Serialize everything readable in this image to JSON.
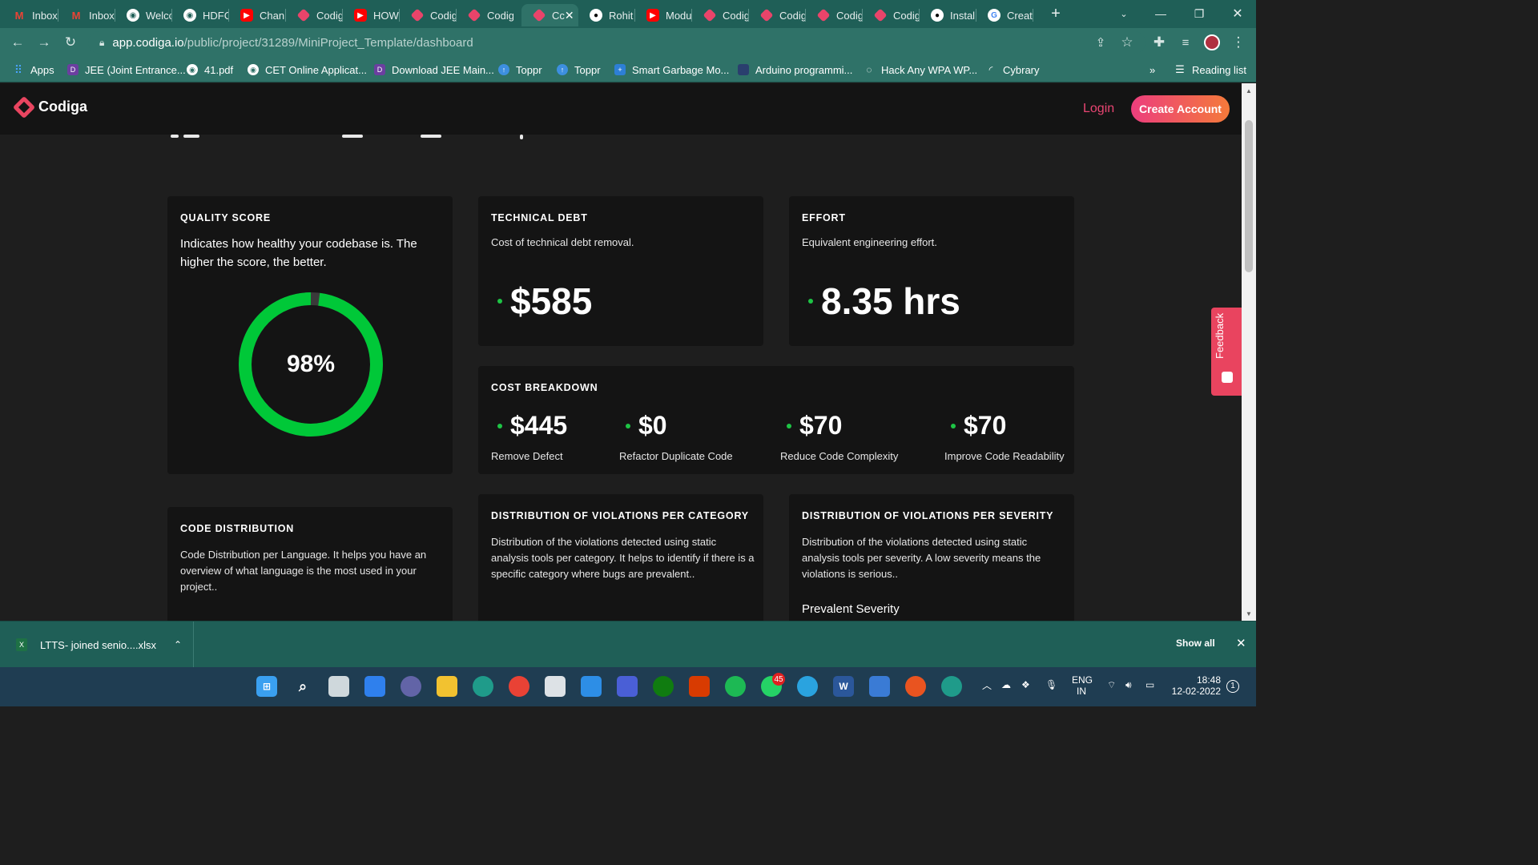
{
  "browser": {
    "tabs": [
      {
        "title": "Inbox",
        "icon": "gmail-icon"
      },
      {
        "title": "Inbox",
        "icon": "gmail-icon"
      },
      {
        "title": "Welcc",
        "icon": "globe-icon"
      },
      {
        "title": "HDFC",
        "icon": "globe-icon"
      },
      {
        "title": "Chan",
        "icon": "youtube-icon"
      },
      {
        "title": "Codig",
        "icon": "codiga-icon"
      },
      {
        "title": "HOW",
        "icon": "youtube-icon"
      },
      {
        "title": "Codig",
        "icon": "codiga-icon"
      },
      {
        "title": "Codig",
        "icon": "codiga-icon"
      },
      {
        "title": "Cc",
        "icon": "codiga-icon",
        "active": true
      },
      {
        "title": "Rohit",
        "icon": "github-icon"
      },
      {
        "title": "Modu",
        "icon": "youtube-icon"
      },
      {
        "title": "Codig",
        "icon": "codiga-icon"
      },
      {
        "title": "Codig",
        "icon": "codiga-icon"
      },
      {
        "title": "Codig",
        "icon": "codiga-icon"
      },
      {
        "title": "Codig",
        "icon": "codiga-icon"
      },
      {
        "title": "Instal",
        "icon": "github-icon"
      },
      {
        "title": "Creat",
        "icon": "google-icon"
      }
    ],
    "url_host": "app.codiga.io",
    "url_path": "/public/project/31289/MiniProject_Template/dashboard",
    "bookmarks": [
      {
        "label": "Apps",
        "icon": "apps-grid-icon"
      },
      {
        "label": "JEE (Joint Entrance...",
        "icon": "bookmark-icon"
      },
      {
        "label": "41.pdf",
        "icon": "globe-icon"
      },
      {
        "label": "CET Online Applicat...",
        "icon": "globe-icon"
      },
      {
        "label": "Download JEE Main...",
        "icon": "bookmark-icon"
      },
      {
        "label": "Toppr",
        "icon": "toppr-icon"
      },
      {
        "label": "Toppr",
        "icon": "toppr-icon"
      },
      {
        "label": "Smart Garbage Mo...",
        "icon": "bookmark-icon"
      },
      {
        "label": "Arduino programmi...",
        "icon": "bookmark-icon"
      },
      {
        "label": "Hack Any WPA WP...",
        "icon": "bookmark-icon"
      },
      {
        "label": "Cybrary",
        "icon": "bookmark-icon"
      }
    ],
    "overflow": "»",
    "reading_list": "Reading list"
  },
  "site": {
    "brand": "Codiga",
    "login": "Login",
    "create_account": "Create Account",
    "feedback": "Feedback"
  },
  "dashboard": {
    "quality": {
      "title": "QUALITY SCORE",
      "desc": "Indicates how healthy your codebase is. The higher the score, the better.",
      "score_label": "98%",
      "score": 0.98,
      "ring_color": "#00c838"
    },
    "debt": {
      "title": "TECHNICAL DEBT",
      "desc": "Cost of technical debt removal.",
      "value": "$585"
    },
    "effort": {
      "title": "EFFORT",
      "desc": "Equivalent engineering effort.",
      "value": "8.35 hrs"
    },
    "cost_breakdown": {
      "title": "COST BREAKDOWN",
      "items": [
        {
          "value": "$445",
          "label": "Remove Defect"
        },
        {
          "value": "$0",
          "label": "Refactor Duplicate Code"
        },
        {
          "value": "$70",
          "label": "Reduce Code Complexity"
        },
        {
          "value": "$70",
          "label": "Improve Code Readability"
        }
      ]
    },
    "code_distribution": {
      "title": "CODE DISTRIBUTION",
      "desc": "Code Distribution per Language. It helps you have an overview of what language is the most used in your project.."
    },
    "violations_category": {
      "title": "DISTRIBUTION OF VIOLATIONS PER CATEGORY",
      "desc": "Distribution of the violations detected using static analysis tools per category. It helps to identify if there is a specific category where bugs are prevalent.."
    },
    "violations_severity": {
      "title": "DISTRIBUTION OF VIOLATIONS PER SEVERITY",
      "desc": "Distribution of the violations detected using static analysis tools per severity. A low severity means the violations is serious..",
      "subheading": "Prevalent Severity"
    }
  },
  "downloads": {
    "file": "LTTS- joined senio....xlsx",
    "show_all": "Show all"
  },
  "taskbar": {
    "whatsapp_badge": "45",
    "lang": "ENG",
    "region": "IN",
    "time": "18:48",
    "date": "12-02-2022",
    "notifications": "1"
  }
}
